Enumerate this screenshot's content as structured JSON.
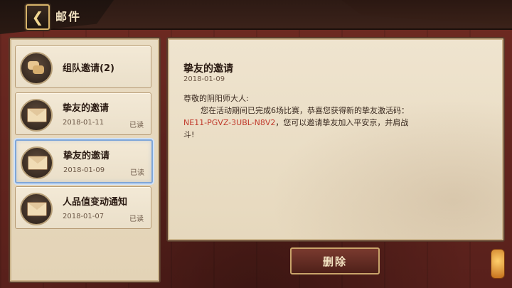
{
  "header": {
    "back_label": "❮",
    "title": "邮件"
  },
  "mail_list": [
    {
      "title": "组队邀请(2)",
      "date": "",
      "status": ""
    },
    {
      "title": "挚友的邀请",
      "date": "2018-01-11",
      "status": "已读"
    },
    {
      "title": "挚友的邀请",
      "date": "2018-01-09",
      "status": "已读"
    },
    {
      "title": "人品值变动通知",
      "date": "2018-01-07",
      "status": "已读"
    }
  ],
  "mail_detail": {
    "title": "挚友的邀请",
    "date": "2018-01-09",
    "greeting": "尊敬的阴阳师大人:",
    "line1": "您在活动期间已完成6场比赛，恭喜您获得新的挚友激活码：",
    "code": "NE11-PGVZ-3UBL-N8V2",
    "line2": "，您可以邀请挚友加入平安京，并肩战",
    "line3": "斗!"
  },
  "buttons": {
    "delete_label": "删除"
  },
  "colors": {
    "code": "#c0392b",
    "selected_border": "#7fa6d8"
  },
  "icons": [
    "back-arrow-icon",
    "team-chat-icon",
    "envelope-icon",
    "lantern-icon"
  ]
}
